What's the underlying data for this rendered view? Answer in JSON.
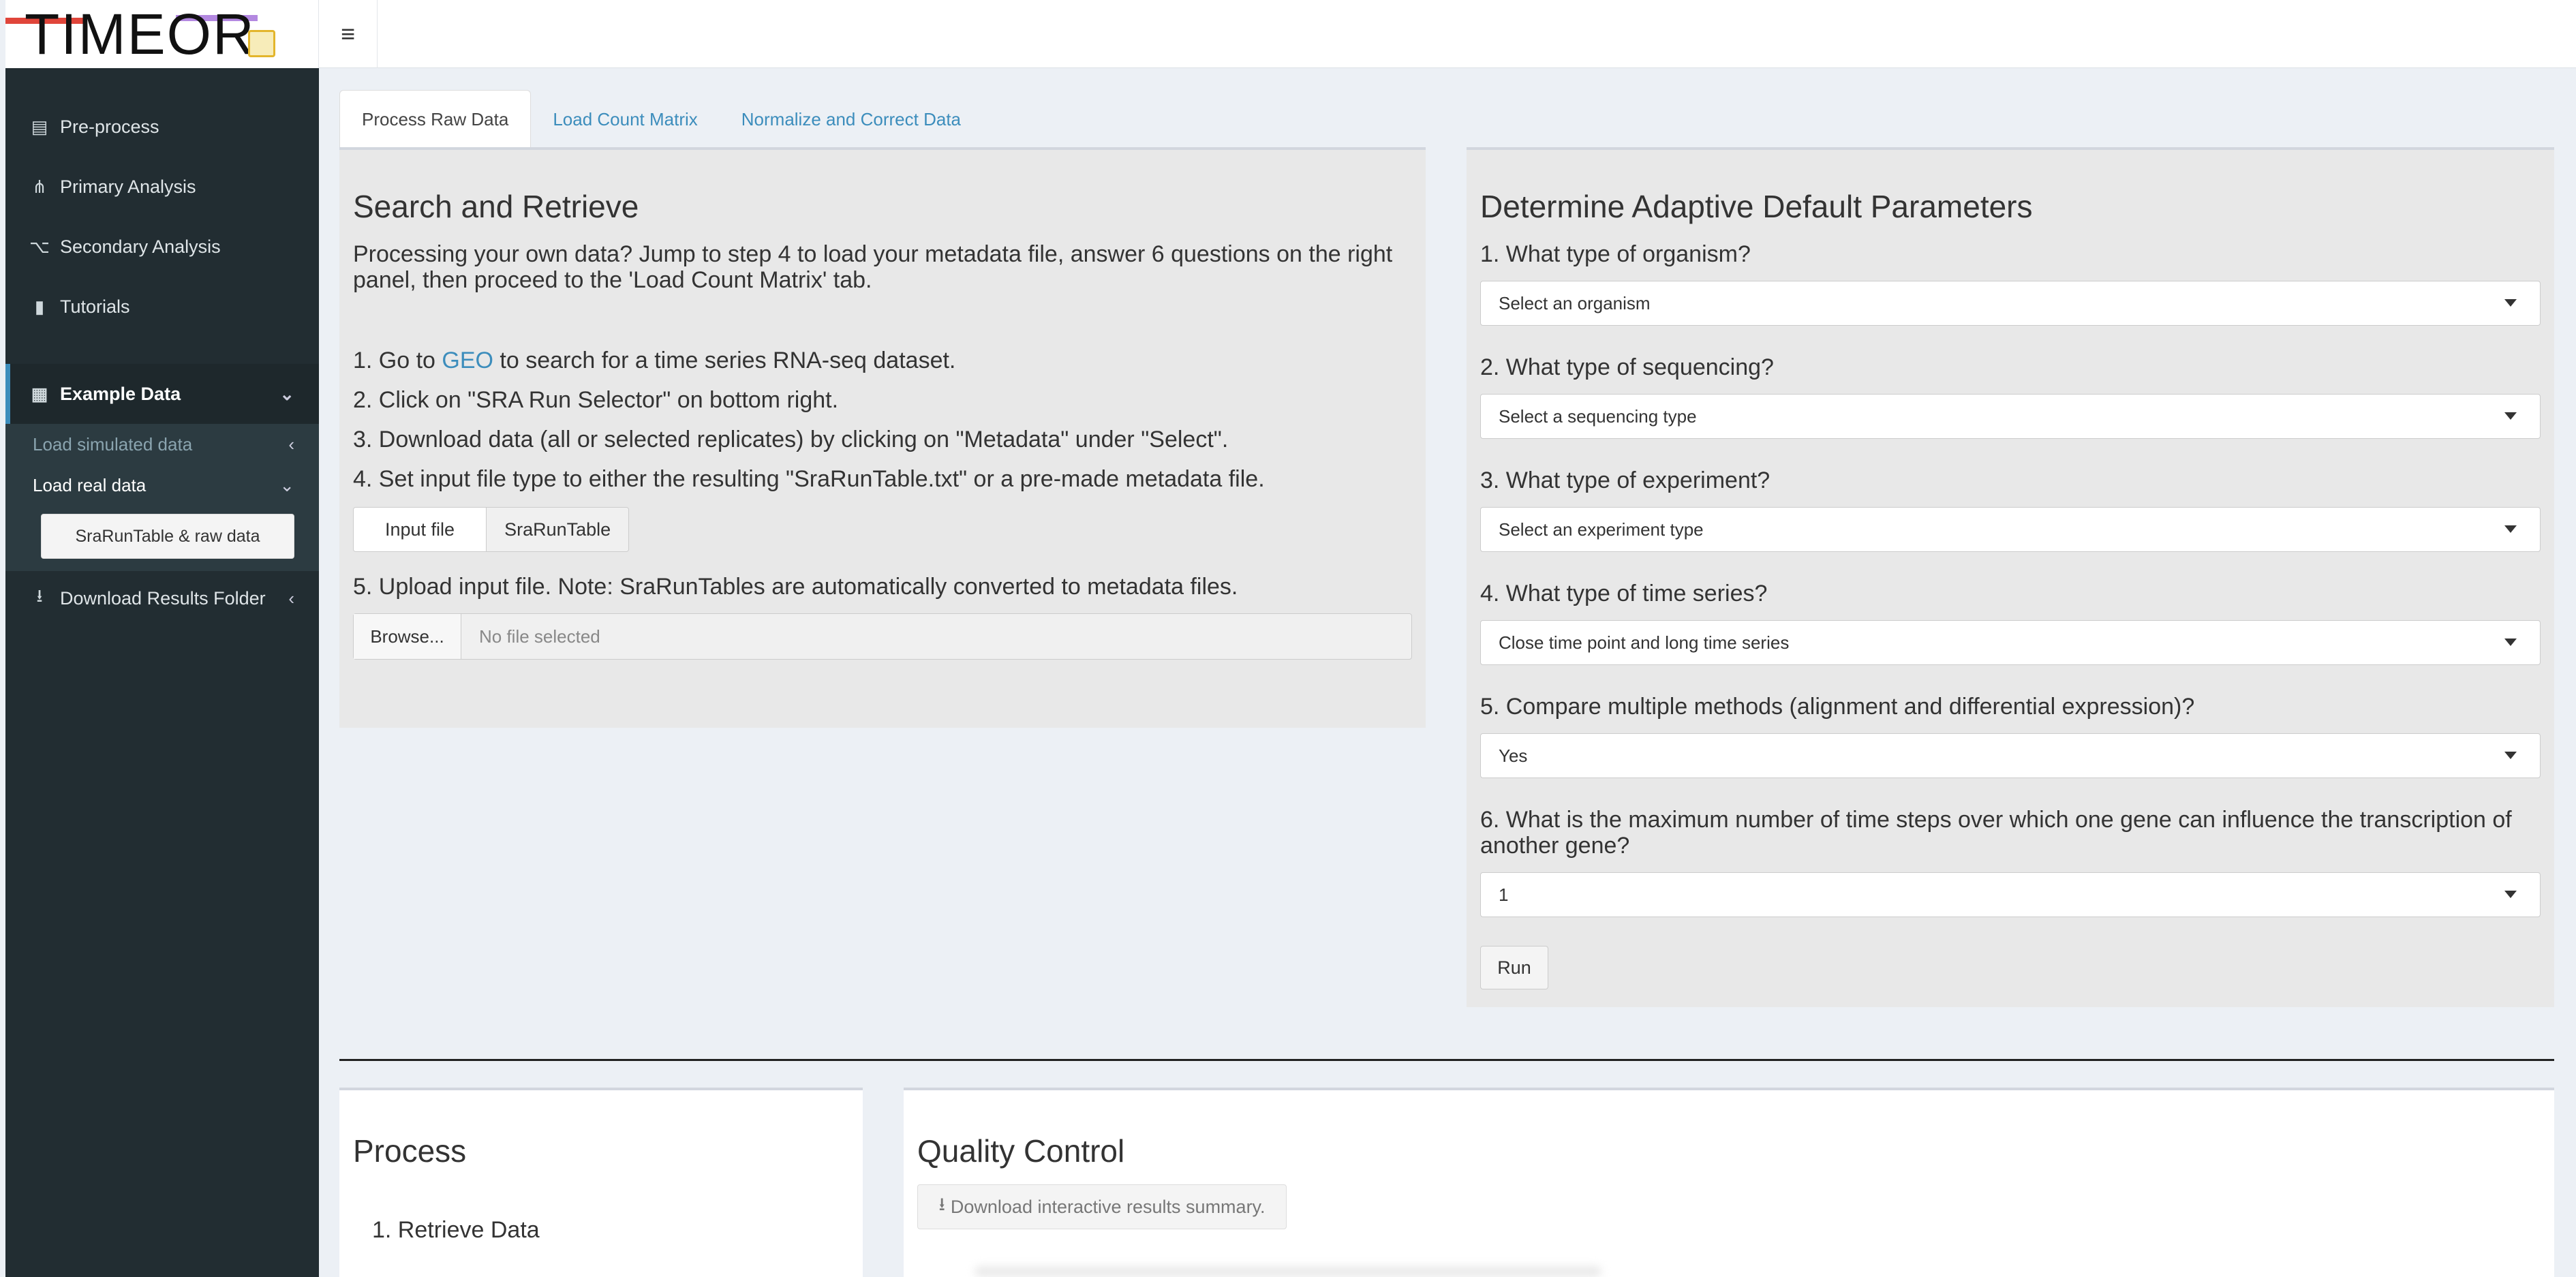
{
  "header": {
    "logo_text": "TIMEOR",
    "menu_icon": "hamburger-icon"
  },
  "sidebar": {
    "items": [
      {
        "label": "Pre-process",
        "icon": "bar-chart-icon"
      },
      {
        "label": "Primary Analysis",
        "icon": "sitemap-icon"
      },
      {
        "label": "Secondary Analysis",
        "icon": "project-diagram-icon"
      },
      {
        "label": "Tutorials",
        "icon": "book-icon"
      }
    ],
    "example": {
      "label": "Example Data",
      "icon": "table-icon"
    },
    "sub": [
      {
        "label": "Load simulated data"
      },
      {
        "label": "Load real data"
      }
    ],
    "sub_button": "SraRunTable & raw data",
    "download": {
      "label": "Download Results Folder",
      "icon": "download-icon"
    }
  },
  "tabs": [
    {
      "label": "Process Raw Data"
    },
    {
      "label": "Load Count Matrix"
    },
    {
      "label": "Normalize and Correct Data"
    }
  ],
  "left_panel": {
    "title": "Search and Retrieve",
    "intro": "Processing your own data? Jump to step 4 to load your metadata file, answer 6 questions on the right panel, then proceed to the 'Load Count Matrix' tab.",
    "step1_pre": "1. Go to ",
    "step1_link": "GEO",
    "step1_post": " to search for a time series RNA-seq dataset.",
    "step2": "2. Click on \"SRA Run Selector\" on bottom right.",
    "step3": "3. Download data (all or selected replicates) by clicking on \"Metadata\" under \"Select\".",
    "step4": "4. Set input file type to either the resulting \"SraRunTable.txt\" or a pre-made metadata file.",
    "seg_options": [
      "Input file",
      "SraRunTable"
    ],
    "step5": "5. Upload input file. Note: SraRunTables are automatically converted to metadata files.",
    "browse": "Browse...",
    "file_placeholder": "No file selected"
  },
  "right_panel": {
    "title": "Determine Adaptive Default Parameters",
    "questions": [
      {
        "q": "1. What type of organism?",
        "value": "Select an organism"
      },
      {
        "q": "2. What type of sequencing?",
        "value": "Select a sequencing type"
      },
      {
        "q": "3. What type of experiment?",
        "value": "Select an experiment type"
      },
      {
        "q": "4. What type of time series?",
        "value": "Close time point and long time series"
      },
      {
        "q": "5. Compare multiple methods (alignment and differential expression)?",
        "value": "Yes"
      },
      {
        "q": "6. What is the maximum number of time steps over which one gene can influence the transcription of another gene?",
        "value": "1"
      }
    ],
    "run": "Run"
  },
  "process_panel": {
    "title": "Process",
    "item": "1. Retrieve Data"
  },
  "qc_panel": {
    "title": "Quality Control",
    "download": "Download interactive results summary."
  }
}
